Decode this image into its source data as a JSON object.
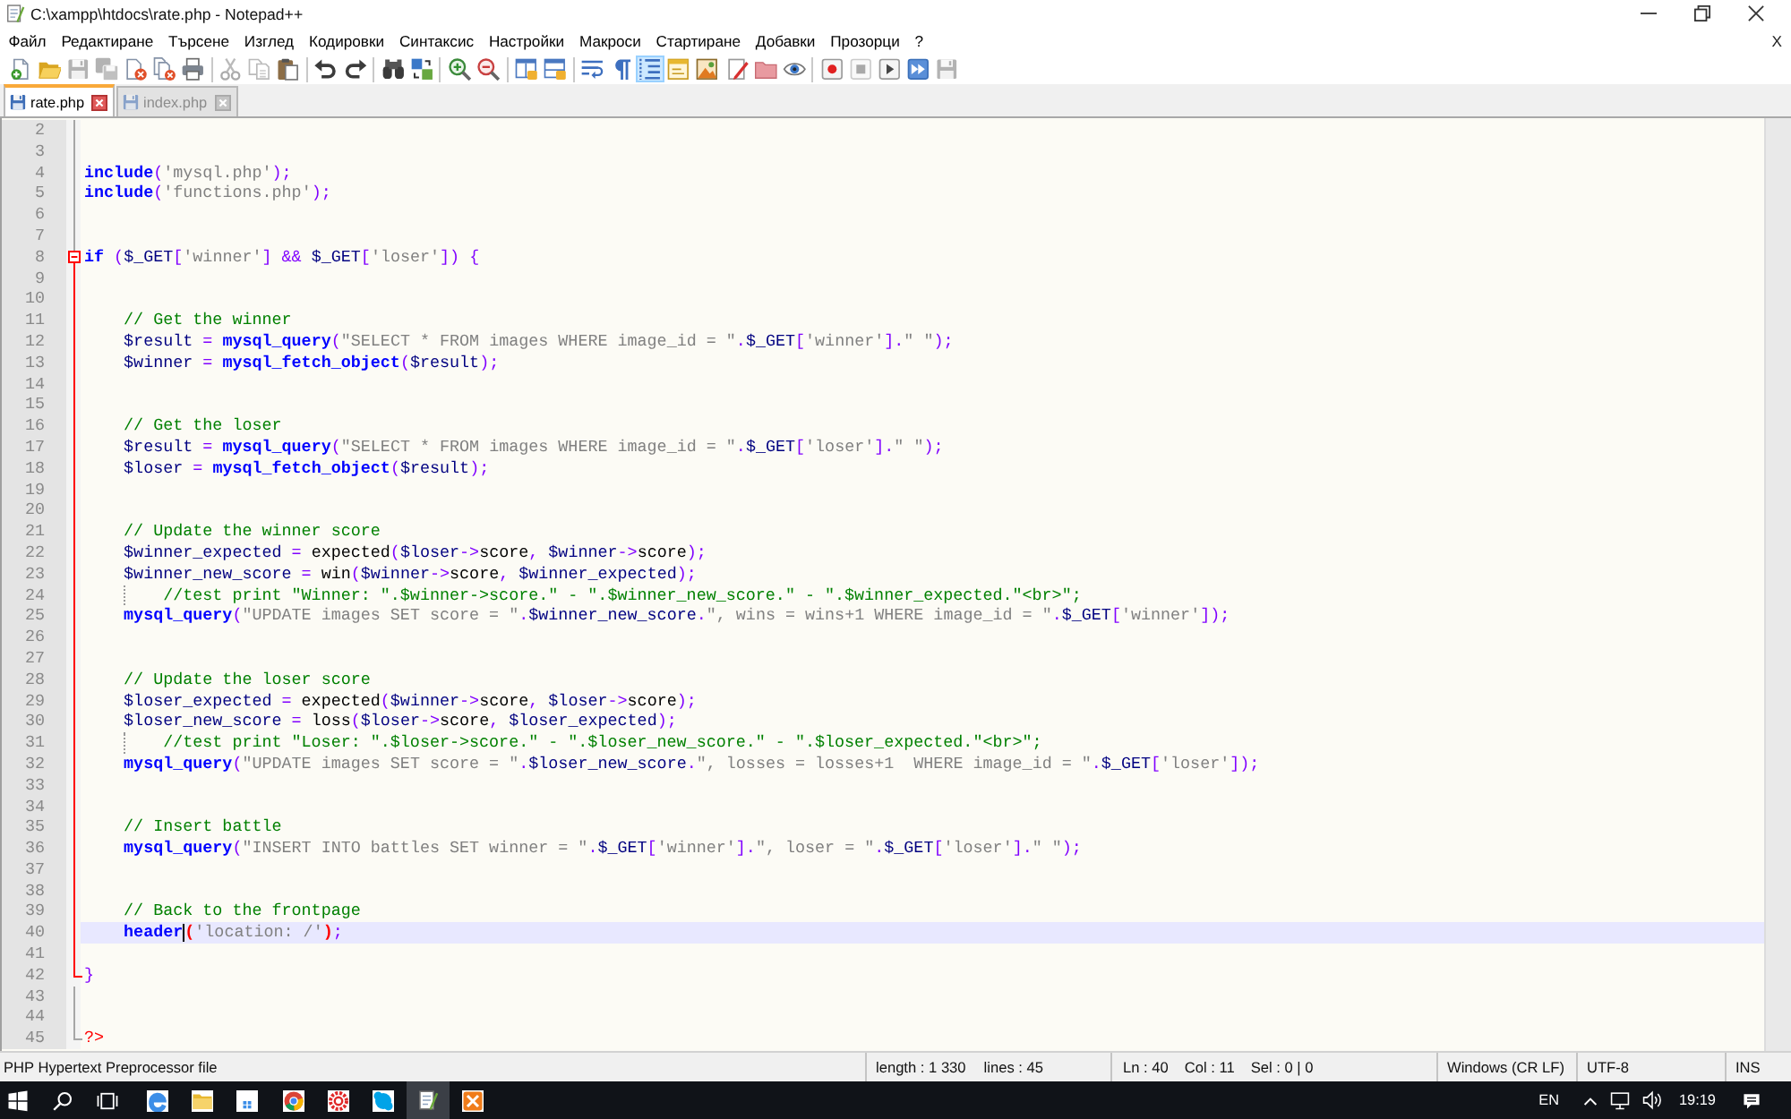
{
  "window": {
    "title": "C:\\xampp\\htdocs\\rate.php - Notepad++"
  },
  "menu": {
    "items": [
      "Файл",
      "Редактиране",
      "Търсене",
      "Изглед",
      "Кодировки",
      "Синтаксис",
      "Настройки",
      "Макроси",
      "Стартиране",
      "Добавки",
      "Прозорци",
      "?"
    ],
    "close_document": "X"
  },
  "toolbar": {
    "buttons": [
      {
        "on": false,
        "disabled": false
      },
      {
        "on": false,
        "disabled": false
      },
      {
        "on": false,
        "disabled": true
      },
      {
        "on": false,
        "disabled": true
      },
      {
        "on": false,
        "disabled": false
      },
      {
        "on": false,
        "disabled": false
      },
      {
        "on": false,
        "disabled": false
      },
      {
        "on": false,
        "disabled": true
      },
      {
        "on": false,
        "disabled": true
      },
      {
        "on": false,
        "disabled": false
      },
      {
        "on": false,
        "disabled": false
      },
      {
        "on": false,
        "disabled": false
      },
      {
        "on": false,
        "disabled": false
      },
      {
        "on": false,
        "disabled": false
      },
      {
        "on": false,
        "disabled": false
      },
      {
        "on": false,
        "disabled": false
      },
      {
        "on": false,
        "disabled": false
      },
      {
        "on": false,
        "disabled": false
      },
      {
        "on": false,
        "disabled": false
      },
      {
        "on": false,
        "disabled": false
      },
      {
        "on": true,
        "disabled": false
      },
      {
        "on": false,
        "disabled": false
      },
      {
        "on": false,
        "disabled": false
      },
      {
        "on": false,
        "disabled": false
      },
      {
        "on": false,
        "disabled": false
      },
      {
        "on": false,
        "disabled": false
      },
      {
        "on": false,
        "disabled": false
      },
      {
        "on": false,
        "disabled": true
      },
      {
        "on": false,
        "disabled": false
      },
      {
        "on": false,
        "disabled": false
      },
      {
        "on": false,
        "disabled": true
      }
    ]
  },
  "tabs": [
    {
      "label": "rate.php",
      "selected": true
    },
    {
      "label": "index.php",
      "selected": false
    }
  ],
  "editor": {
    "lines": [
      {
        "number": "2",
        "current": false
      },
      {
        "number": "3",
        "current": false
      },
      {
        "number": "4",
        "current": false,
        "tokens": [
          {
            "kind": "keyword",
            "text": "include"
          },
          {
            "kind": "operator",
            "text": "("
          },
          {
            "kind": "string",
            "text": "'mysql.php'"
          },
          {
            "kind": "operator",
            "text": ");"
          }
        ]
      },
      {
        "number": "5",
        "current": false,
        "tokens": [
          {
            "kind": "keyword",
            "text": "include"
          },
          {
            "kind": "operator",
            "text": "("
          },
          {
            "kind": "string",
            "text": "'functions.php'"
          },
          {
            "kind": "operator",
            "text": ");"
          }
        ]
      },
      {
        "number": "6",
        "current": false
      },
      {
        "number": "7",
        "current": false
      },
      {
        "number": "8",
        "current": false,
        "expanded": true,
        "tokens": [
          {
            "kind": "keyword",
            "text": "if"
          },
          {
            "kind": "operator",
            "text": " ("
          },
          {
            "kind": "variable",
            "text": "$_GET"
          },
          {
            "kind": "operator",
            "text": "["
          },
          {
            "kind": "string",
            "text": "'winner'"
          },
          {
            "kind": "operator",
            "text": "] && "
          },
          {
            "kind": "variable",
            "text": "$_GET"
          },
          {
            "kind": "operator",
            "text": "["
          },
          {
            "kind": "string",
            "text": "'loser'"
          },
          {
            "kind": "operator",
            "text": "]) {"
          }
        ],
        "children": [
          {
            "number": "9",
            "current": false
          },
          {
            "number": "10",
            "current": false
          },
          {
            "number": "11",
            "current": false,
            "tokens": [
              {
                "kind": "comment",
                "text": "// Get the winner"
              }
            ]
          },
          {
            "number": "12",
            "current": false,
            "tokens": [
              {
                "kind": "variable",
                "text": "$result"
              },
              {
                "kind": "operator",
                "text": " = "
              },
              {
                "kind": "keyword",
                "text": "mysql_query"
              },
              {
                "kind": "operator",
                "text": "("
              },
              {
                "kind": "string",
                "text": "\"SELECT * FROM images WHERE image_id = \""
              },
              {
                "kind": "operator",
                "text": "."
              },
              {
                "kind": "variable",
                "text": "$_GET"
              },
              {
                "kind": "operator",
                "text": "["
              },
              {
                "kind": "string",
                "text": "'winner'"
              },
              {
                "kind": "operator",
                "text": "]."
              },
              {
                "kind": "string",
                "text": "\" \""
              },
              {
                "kind": "operator",
                "text": ");"
              }
            ]
          },
          {
            "number": "13",
            "current": false,
            "tokens": [
              {
                "kind": "variable",
                "text": "$winner"
              },
              {
                "kind": "operator",
                "text": " = "
              },
              {
                "kind": "keyword",
                "text": "mysql_fetch_object"
              },
              {
                "kind": "operator",
                "text": "("
              },
              {
                "kind": "variable",
                "text": "$result"
              },
              {
                "kind": "operator",
                "text": ");"
              }
            ]
          },
          {
            "number": "14",
            "current": false
          },
          {
            "number": "15",
            "current": false
          },
          {
            "number": "16",
            "current": false,
            "tokens": [
              {
                "kind": "comment",
                "text": "// Get the loser"
              }
            ]
          },
          {
            "number": "17",
            "current": false,
            "tokens": [
              {
                "kind": "variable",
                "text": "$result"
              },
              {
                "kind": "operator",
                "text": " = "
              },
              {
                "kind": "keyword",
                "text": "mysql_query"
              },
              {
                "kind": "operator",
                "text": "("
              },
              {
                "kind": "string",
                "text": "\"SELECT * FROM images WHERE image_id = \""
              },
              {
                "kind": "operator",
                "text": "."
              },
              {
                "kind": "variable",
                "text": "$_GET"
              },
              {
                "kind": "operator",
                "text": "["
              },
              {
                "kind": "string",
                "text": "'loser'"
              },
              {
                "kind": "operator",
                "text": "]."
              },
              {
                "kind": "string",
                "text": "\" \""
              },
              {
                "kind": "operator",
                "text": ");"
              }
            ]
          },
          {
            "number": "18",
            "current": false,
            "tokens": [
              {
                "kind": "variable",
                "text": "$loser"
              },
              {
                "kind": "operator",
                "text": " = "
              },
              {
                "kind": "keyword",
                "text": "mysql_fetch_object"
              },
              {
                "kind": "operator",
                "text": "("
              },
              {
                "kind": "variable",
                "text": "$result"
              },
              {
                "kind": "operator",
                "text": ");"
              }
            ]
          },
          {
            "number": "19",
            "current": false
          },
          {
            "number": "20",
            "current": false
          },
          {
            "number": "21",
            "current": false,
            "tokens": [
              {
                "kind": "comment",
                "text": "// Update the winner score"
              }
            ]
          },
          {
            "number": "22",
            "current": false,
            "tokens": [
              {
                "kind": "variable",
                "text": "$winner_expected"
              },
              {
                "kind": "operator",
                "text": " = "
              },
              {
                "kind": "plain",
                "text": "expected"
              },
              {
                "kind": "operator",
                "text": "("
              },
              {
                "kind": "variable",
                "text": "$loser"
              },
              {
                "kind": "operator",
                "text": "->"
              },
              {
                "kind": "plain",
                "text": "score"
              },
              {
                "kind": "operator",
                "text": ", "
              },
              {
                "kind": "variable",
                "text": "$winner"
              },
              {
                "kind": "operator",
                "text": "->"
              },
              {
                "kind": "plain",
                "text": "score"
              },
              {
                "kind": "operator",
                "text": ");"
              }
            ]
          },
          {
            "number": "23",
            "current": false,
            "tokens": [
              {
                "kind": "variable",
                "text": "$winner_new_score"
              },
              {
                "kind": "operator",
                "text": " = "
              },
              {
                "kind": "plain",
                "text": "win"
              },
              {
                "kind": "operator",
                "text": "("
              },
              {
                "kind": "variable",
                "text": "$winner"
              },
              {
                "kind": "operator",
                "text": "->"
              },
              {
                "kind": "plain",
                "text": "score"
              },
              {
                "kind": "operator",
                "text": ", "
              },
              {
                "kind": "variable",
                "text": "$winner_expected"
              },
              {
                "kind": "operator",
                "text": ");"
              }
            ],
            "children": [
              {
                "number": "24",
                "current": false,
                "tokens": [
                  {
                    "kind": "comment",
                    "text": "//test print \"Winner: \".$winner->score.\" - \".$winner_new_score.\" - \".$winner_expected.\"<br>\";"
                  }
                ]
              }
            ]
          },
          {
            "number": "25",
            "current": false,
            "tokens": [
              {
                "kind": "keyword",
                "text": "mysql_query"
              },
              {
                "kind": "operator",
                "text": "("
              },
              {
                "kind": "string",
                "text": "\"UPDATE images SET score = \""
              },
              {
                "kind": "operator",
                "text": "."
              },
              {
                "kind": "variable",
                "text": "$winner_new_score"
              },
              {
                "kind": "operator",
                "text": "."
              },
              {
                "kind": "string",
                "text": "\", wins = wins+1 WHERE image_id = \""
              },
              {
                "kind": "operator",
                "text": "."
              },
              {
                "kind": "variable",
                "text": "$_GET"
              },
              {
                "kind": "operator",
                "text": "["
              },
              {
                "kind": "string",
                "text": "'winner'"
              },
              {
                "kind": "operator",
                "text": "]);"
              }
            ]
          },
          {
            "number": "26",
            "current": false
          },
          {
            "number": "27",
            "current": false
          },
          {
            "number": "28",
            "current": false,
            "tokens": [
              {
                "kind": "comment",
                "text": "// Update the loser score"
              }
            ]
          },
          {
            "number": "29",
            "current": false,
            "tokens": [
              {
                "kind": "variable",
                "text": "$loser_expected"
              },
              {
                "kind": "operator",
                "text": " = "
              },
              {
                "kind": "plain",
                "text": "expected"
              },
              {
                "kind": "operator",
                "text": "("
              },
              {
                "kind": "variable",
                "text": "$winner"
              },
              {
                "kind": "operator",
                "text": "->"
              },
              {
                "kind": "plain",
                "text": "score"
              },
              {
                "kind": "operator",
                "text": ", "
              },
              {
                "kind": "variable",
                "text": "$loser"
              },
              {
                "kind": "operator",
                "text": "->"
              },
              {
                "kind": "plain",
                "text": "score"
              },
              {
                "kind": "operator",
                "text": ");"
              }
            ]
          },
          {
            "number": "30",
            "current": false,
            "tokens": [
              {
                "kind": "variable",
                "text": "$loser_new_score"
              },
              {
                "kind": "operator",
                "text": " = "
              },
              {
                "kind": "plain",
                "text": "loss"
              },
              {
                "kind": "operator",
                "text": "("
              },
              {
                "kind": "variable",
                "text": "$loser"
              },
              {
                "kind": "operator",
                "text": "->"
              },
              {
                "kind": "plain",
                "text": "score"
              },
              {
                "kind": "operator",
                "text": ", "
              },
              {
                "kind": "variable",
                "text": "$loser_expected"
              },
              {
                "kind": "operator",
                "text": ");"
              }
            ],
            "children": [
              {
                "number": "31",
                "current": false,
                "tokens": [
                  {
                    "kind": "comment",
                    "text": "//test print \"Loser: \".$loser->score.\" - \".$loser_new_score.\" - \".$loser_expected.\"<br>\";"
                  }
                ]
              }
            ]
          },
          {
            "number": "32",
            "current": false,
            "tokens": [
              {
                "kind": "keyword",
                "text": "mysql_query"
              },
              {
                "kind": "operator",
                "text": "("
              },
              {
                "kind": "string",
                "text": "\"UPDATE images SET score = \""
              },
              {
                "kind": "operator",
                "text": "."
              },
              {
                "kind": "variable",
                "text": "$loser_new_score"
              },
              {
                "kind": "operator",
                "text": "."
              },
              {
                "kind": "string",
                "text": "\", losses = losses+1  WHERE image_id = \""
              },
              {
                "kind": "operator",
                "text": "."
              },
              {
                "kind": "variable",
                "text": "$_GET"
              },
              {
                "kind": "operator",
                "text": "["
              },
              {
                "kind": "string",
                "text": "'loser'"
              },
              {
                "kind": "operator",
                "text": "]);"
              }
            ]
          },
          {
            "number": "33",
            "current": false
          },
          {
            "number": "34",
            "current": false
          },
          {
            "number": "35",
            "current": false,
            "tokens": [
              {
                "kind": "comment",
                "text": "// Insert battle"
              }
            ]
          },
          {
            "number": "36",
            "current": false,
            "tokens": [
              {
                "kind": "keyword",
                "text": "mysql_query"
              },
              {
                "kind": "operator",
                "text": "("
              },
              {
                "kind": "string",
                "text": "\"INSERT INTO battles SET winner = \""
              },
              {
                "kind": "operator",
                "text": "."
              },
              {
                "kind": "variable",
                "text": "$_GET"
              },
              {
                "kind": "operator",
                "text": "["
              },
              {
                "kind": "string",
                "text": "'winner'"
              },
              {
                "kind": "operator",
                "text": "]."
              },
              {
                "kind": "string",
                "text": "\", loser = \""
              },
              {
                "kind": "operator",
                "text": "."
              },
              {
                "kind": "variable",
                "text": "$_GET"
              },
              {
                "kind": "operator",
                "text": "["
              },
              {
                "kind": "string",
                "text": "'loser'"
              },
              {
                "kind": "operator",
                "text": "]."
              },
              {
                "kind": "string",
                "text": "\" \""
              },
              {
                "kind": "operator",
                "text": ");"
              }
            ]
          },
          {
            "number": "37",
            "current": false
          },
          {
            "number": "38",
            "current": false
          },
          {
            "number": "39",
            "current": false,
            "tokens": [
              {
                "kind": "comment",
                "text": "// Back to the frontpage"
              }
            ]
          },
          {
            "number": "40",
            "current": true,
            "tokens": [
              {
                "kind": "keyword",
                "text": "header"
              },
              {
                "kind": "caret"
              },
              {
                "kind": "brace-match",
                "text": "("
              },
              {
                "kind": "string",
                "text": "'location: /'"
              },
              {
                "kind": "brace-match",
                "text": ")"
              },
              {
                "kind": "operator",
                "text": ";"
              }
            ]
          },
          {
            "number": "41",
            "current": false
          }
        ],
        "end": {
          "number": "42",
          "current": false,
          "tokens": [
            {
              "kind": "operator",
              "text": "}"
            }
          ]
        }
      },
      {
        "number": "43",
        "current": false
      },
      {
        "number": "44",
        "current": false
      },
      {
        "number": "45",
        "current": false,
        "tokens": [
          {
            "kind": "delimiter",
            "text": "?>"
          }
        ]
      }
    ]
  },
  "status_bar": {
    "file_type": "PHP Hypertext Preprocessor file",
    "length": "length : 1 330",
    "lines": "lines : 45",
    "line": "Ln : 40",
    "column": "Col : 11",
    "selection": "Sel : 0 | 0",
    "eol": "Windows (CR LF)",
    "encoding": "UTF-8",
    "mode": "INS"
  },
  "taskbar": {
    "apps": [
      {
        "selected": false
      },
      {
        "selected": false
      },
      {
        "selected": false
      },
      {
        "selected": false
      },
      {
        "selected": false
      },
      {
        "selected": false
      },
      {
        "selected": true
      },
      {
        "selected": false
      }
    ],
    "language": "EN",
    "time": "19:19"
  }
}
